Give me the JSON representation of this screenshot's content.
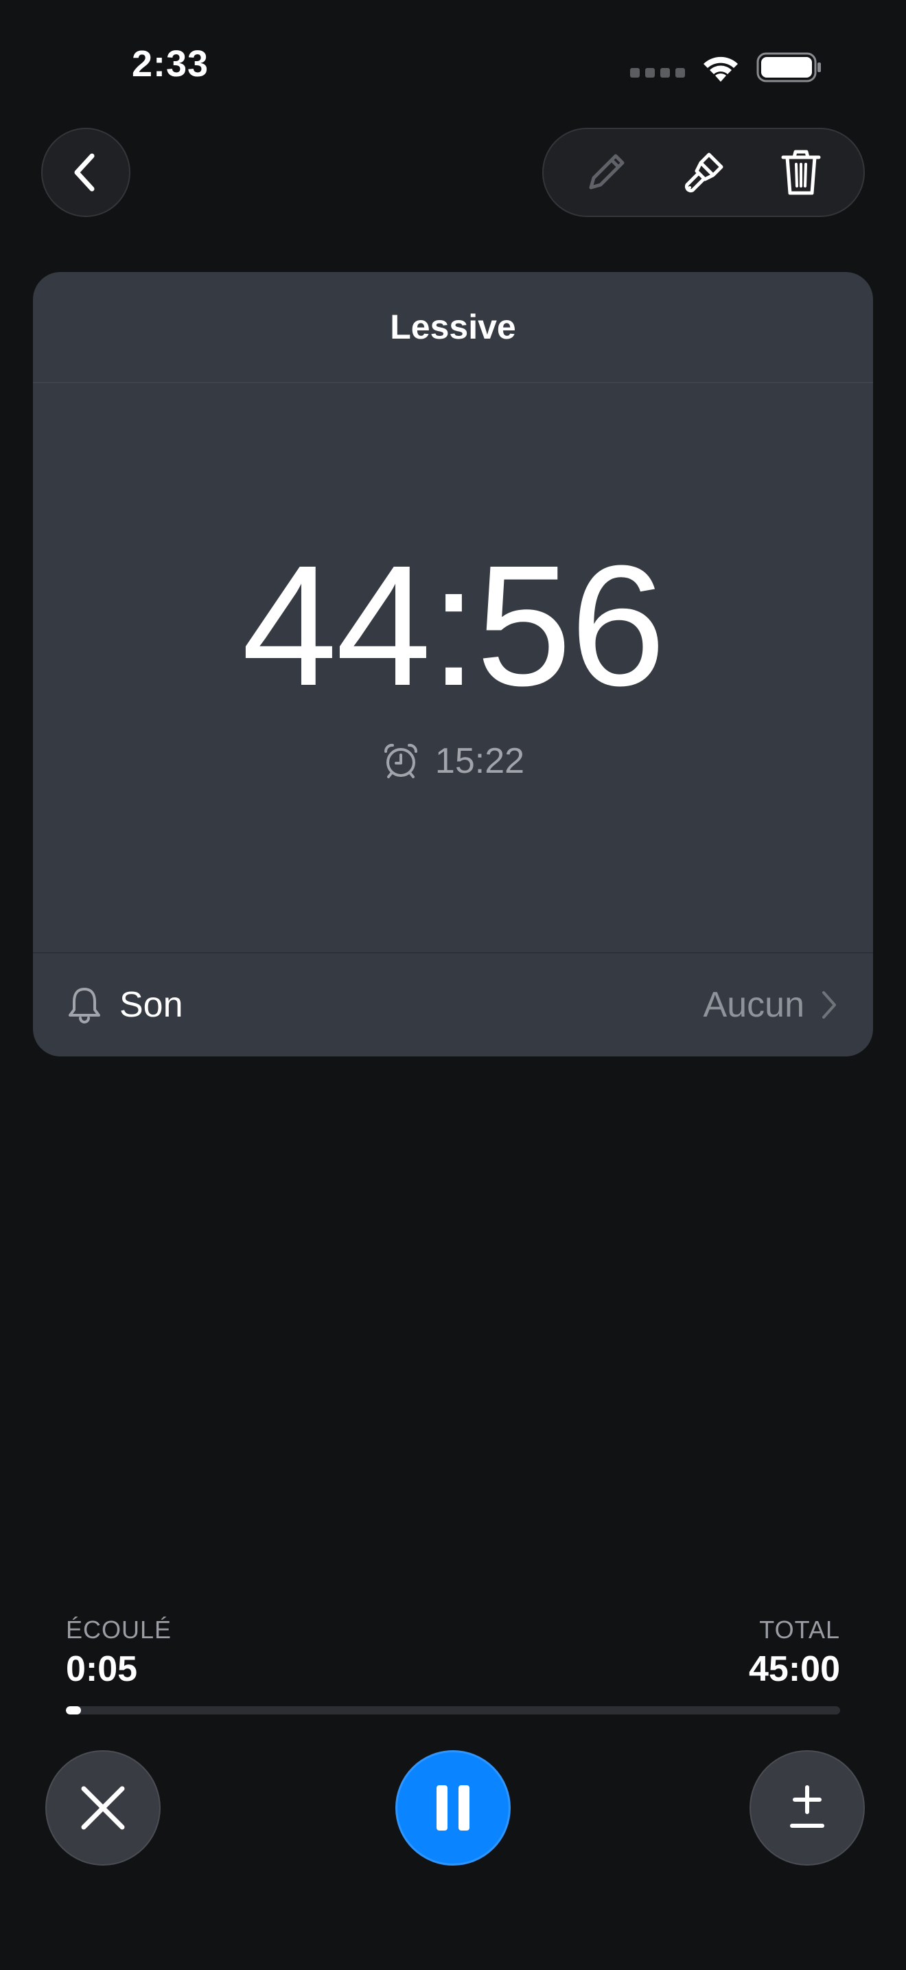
{
  "status_bar": {
    "time": "2:33"
  },
  "nav": {
    "back_icon": "chevron-left-icon",
    "tools": [
      "pencil-icon",
      "paintbrush-icon",
      "trash-icon"
    ]
  },
  "timer": {
    "name": "Lessive",
    "remaining": "44:56",
    "end_time": "15:22",
    "sound_label": "Son",
    "sound_value": "Aucun"
  },
  "progress": {
    "elapsed_label": "ÉCOULÉ",
    "elapsed_value": "0:05",
    "total_label": "TOTAL",
    "total_value": "45:00",
    "fraction": 0.0019
  },
  "colors": {
    "background": "#111214",
    "card": "#363a42",
    "accent": "#0a84ff"
  }
}
